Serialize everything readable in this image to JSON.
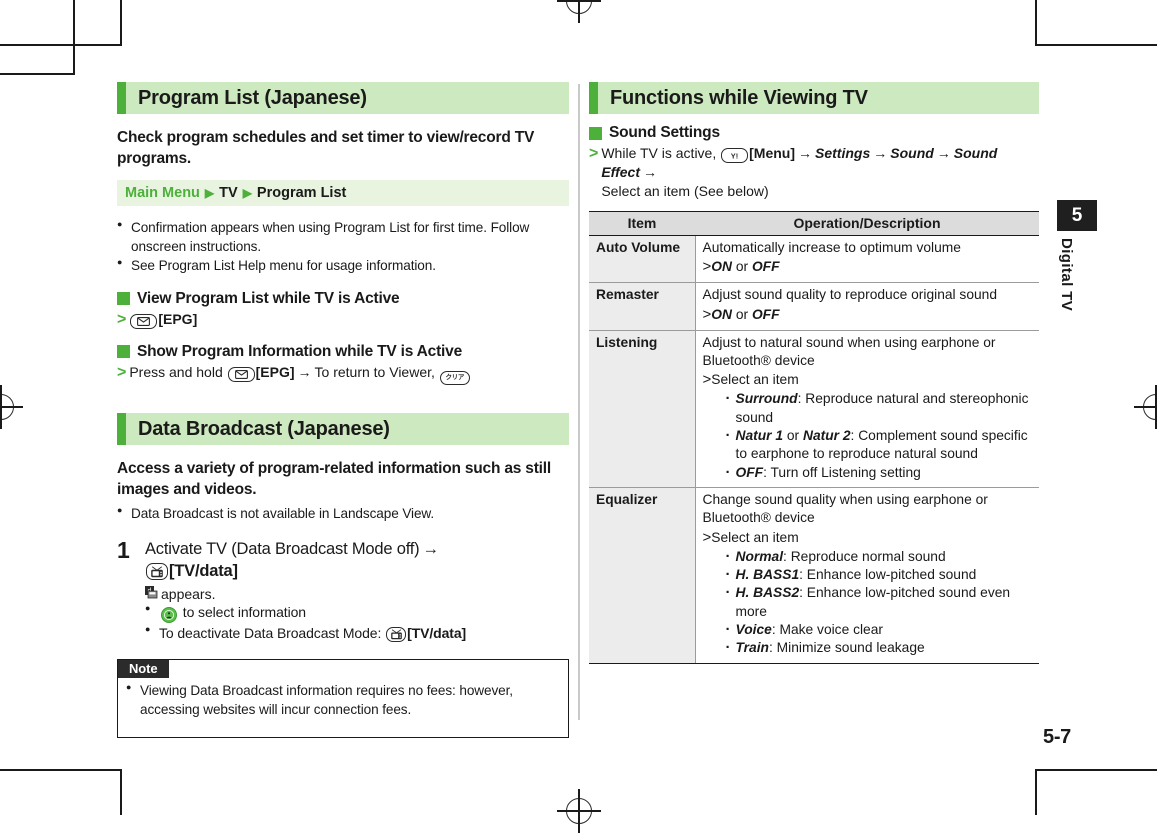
{
  "page": {
    "number": "5-7",
    "chapter_number": "5",
    "chapter_label": "Digital TV"
  },
  "left_column": {
    "section1": {
      "title": "Program List (Japanese)",
      "lead": "Check program schedules and set timer to view/record TV programs.",
      "menu_path": {
        "root": "Main Menu",
        "step1": "TV",
        "step2": "Program List"
      },
      "bullets": [
        "Confirmation appears when using Program List for first time. Follow onscreen instructions.",
        "See Program List Help menu for usage information."
      ],
      "sub1": {
        "heading": "View Program List while TV is Active",
        "key_epg_label": "[EPG]"
      },
      "sub2": {
        "heading": "Show Program Information while TV is Active",
        "prefix": "Press and hold",
        "key_epg_label": "[EPG]",
        "arrow": "→",
        "suffix": "To return to Viewer,"
      }
    },
    "section2": {
      "title": "Data Broadcast (Japanese)",
      "lead": "Access a variety of program-related information such as still images and videos.",
      "bullets": [
        "Data Broadcast is not available in Landscape View."
      ],
      "step": {
        "number": "1",
        "text_line1": "Activate TV (Data Broadcast Mode off)",
        "arrow": "→",
        "key_tvdata_label": "[TV/data]",
        "appears_text": "appears.",
        "subbullets": [
          "to select information",
          "To deactivate Data Broadcast Mode:"
        ],
        "deactivate_key_label": "[TV/data]"
      },
      "note": {
        "tab_label": "Note",
        "items": [
          "Viewing Data Broadcast information requires no fees: however, accessing websites will incur connection fees."
        ]
      }
    }
  },
  "right_column": {
    "section": {
      "title": "Functions while Viewing TV",
      "sub_heading": "Sound Settings",
      "operation": {
        "prefix": "While TV is active,",
        "key_menu_label": "[Menu]",
        "arrow": "→",
        "path1": "Settings",
        "path2": "Sound",
        "path3": "Sound Effect",
        "suffix": "Select an item (See below)"
      },
      "table": {
        "headers": [
          "Item",
          "Operation/Description"
        ],
        "rows": [
          {
            "item": "Auto Volume",
            "desc": "Automatically increase to optimum volume",
            "option_line": {
              "opt1": "ON",
              "conj": "or",
              "opt2": "OFF"
            },
            "subitems": []
          },
          {
            "item": "Remaster",
            "desc": "Adjust sound quality to reproduce original sound",
            "option_line": {
              "opt1": "ON",
              "conj": "or",
              "opt2": "OFF"
            },
            "subitems": []
          },
          {
            "item": "Listening",
            "desc": "Adjust to natural sound when using earphone or Bluetooth® device",
            "select_label": "Select an item",
            "subitems": [
              {
                "name": "Surround",
                "text": ": Reproduce natural and stereophonic sound"
              },
              {
                "name": "Natur 1",
                "conj": " or ",
                "name2": "Natur 2",
                "text": ": Complement sound specific to earphone to reproduce natural sound"
              },
              {
                "name": "OFF",
                "text": ": Turn off Listening setting"
              }
            ]
          },
          {
            "item": "Equalizer",
            "desc": "Change sound quality when using earphone or Bluetooth® device",
            "select_label": "Select an item",
            "subitems": [
              {
                "name": "Normal",
                "text": ": Reproduce normal sound"
              },
              {
                "name": "H. BASS1",
                "text": ": Enhance low-pitched sound"
              },
              {
                "name": "H. BASS2",
                "text": ": Enhance low-pitched sound even more"
              },
              {
                "name": "Voice",
                "text": ": Make voice clear"
              },
              {
                "name": "Train",
                "text": ": Minimize sound leakage"
              }
            ]
          }
        ]
      }
    }
  },
  "icons": {
    "epg_key": "envelope-key-icon",
    "tvdata_key": "tv-key-icon",
    "menu_key": "yahoo-menu-key-icon",
    "clear_key": "clear-key-icon",
    "nav_key": "center-nav-key-icon",
    "data_broadcast_indicator": "data-broadcast-indicator-icon"
  },
  "colors": {
    "accent_green": "#4cb03a",
    "header_green": "#cde9bf",
    "menu_bar_green": "#e8f4e0",
    "table_head_gray": "#dcdcdc",
    "table_item_gray": "#ececec"
  }
}
